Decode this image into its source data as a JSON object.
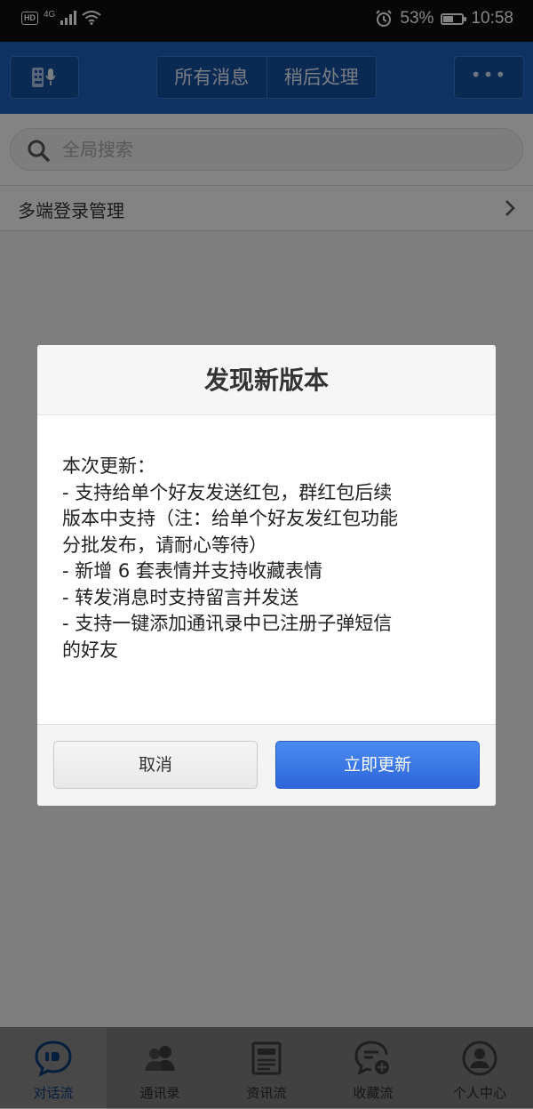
{
  "status_bar": {
    "hd": "HD",
    "network": "4G",
    "battery": "53%",
    "time": "10:58"
  },
  "header": {
    "tabs": [
      "所有消息",
      "稍后处理"
    ],
    "more": "•••"
  },
  "search": {
    "placeholder": "全局搜索"
  },
  "list": {
    "multi_login": "多端登录管理"
  },
  "dialog": {
    "title": "发现新版本",
    "body": [
      "本次更新：",
      "- 支持给单个好友发送红包，群红包后续",
      "版本中支持（注：给单个好友发红包功能",
      "分批发布，请耐心等待）",
      "- 新增 6 套表情并支持收藏表情",
      "- 转发消息时支持留言并发送",
      "- 支持一键添加通讯录中已注册子弹短信",
      "的好友"
    ],
    "cancel": "取消",
    "update": "立即更新"
  },
  "tabbar": {
    "items": [
      "对话流",
      "通讯录",
      "资讯流",
      "收藏流",
      "个人中心"
    ],
    "active_index": 0
  },
  "colors": {
    "header_blue": "#1b62bf",
    "primary_button": "#3a76e6",
    "active_tab": "#0b3a78"
  }
}
